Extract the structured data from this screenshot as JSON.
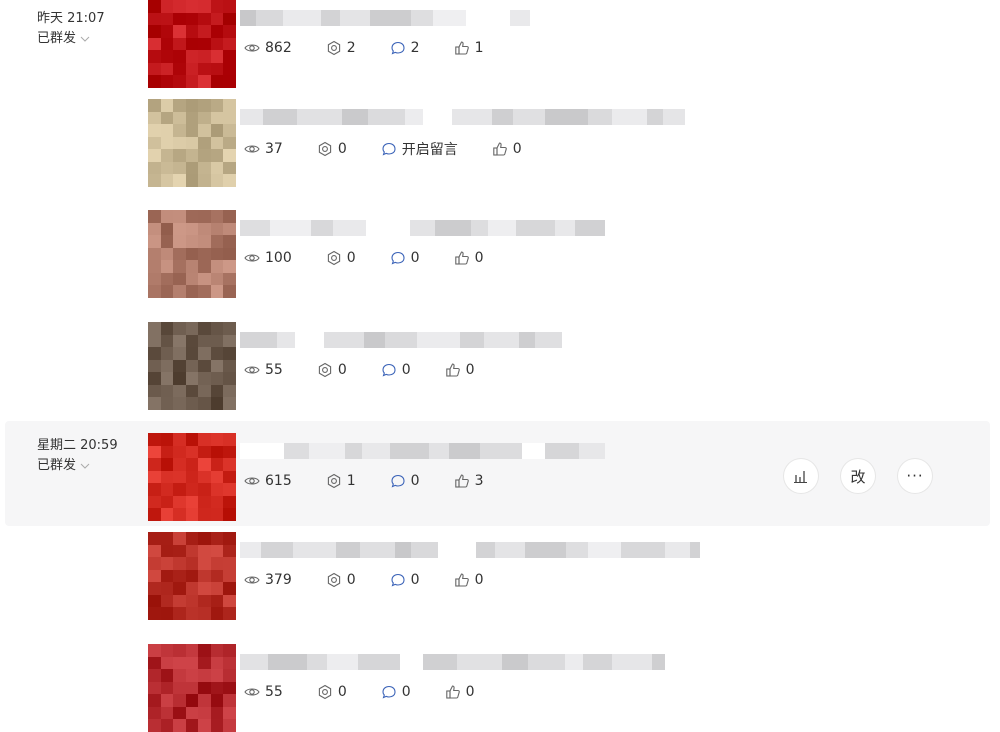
{
  "groups": [
    {
      "time": "昨天 21:07",
      "status": "已群发"
    },
    {
      "time": "星期二 20:59",
      "status": "已群发"
    }
  ],
  "items": [
    {
      "views": "862",
      "shares": "2",
      "comments": "2",
      "likes": "1",
      "thumb_color": "#c0161a"
    },
    {
      "views": "37",
      "shares": "0",
      "comments": "开启留言",
      "likes": "0",
      "thumb_color": "#c9b995"
    },
    {
      "views": "100",
      "shares": "0",
      "comments": "0",
      "likes": "0",
      "thumb_color": "#b07b6a"
    },
    {
      "views": "55",
      "shares": "0",
      "comments": "0",
      "likes": "0",
      "thumb_color": "#6b5a4c"
    },
    {
      "views": "615",
      "shares": "1",
      "comments": "0",
      "likes": "3",
      "thumb_color": "#d22a20"
    },
    {
      "views": "379",
      "shares": "0",
      "comments": "0",
      "likes": "0",
      "thumb_color": "#b83027"
    },
    {
      "views": "55",
      "shares": "0",
      "comments": "0",
      "likes": "0",
      "thumb_color": "#b1262b"
    }
  ],
  "actions": {
    "edit_label": "改",
    "more_label": "···"
  },
  "icons": {
    "views": "eye-icon",
    "shares": "share-icon",
    "comments": "comment-icon",
    "likes": "thumbs-up-icon",
    "stats": "bar-chart-icon"
  }
}
